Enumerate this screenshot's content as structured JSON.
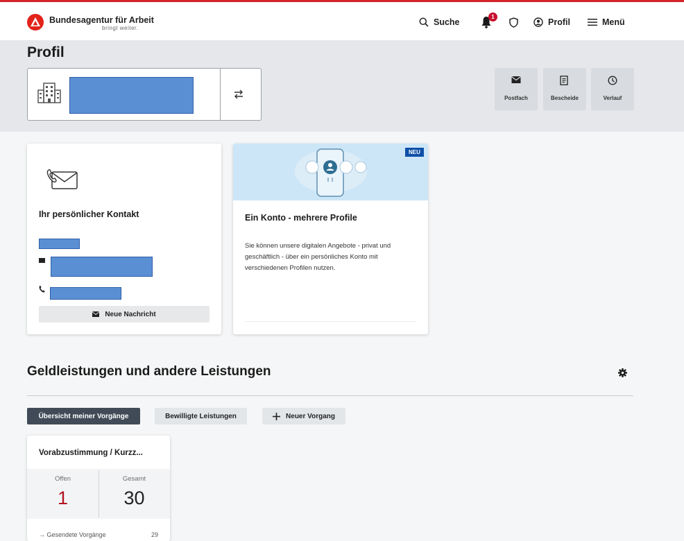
{
  "header": {
    "brand_name": "Bundesagentur für Arbeit",
    "brand_tagline": "bringt weiter.",
    "nav": {
      "search_label": "Suche",
      "notification_count": "1",
      "profile_label": "Profil",
      "menu_label": "Menü"
    }
  },
  "page": {
    "title": "Profil"
  },
  "quick_actions": [
    {
      "label": "Postfach",
      "icon": "envelope-icon"
    },
    {
      "label": "Bescheide",
      "icon": "document-icon"
    },
    {
      "label": "Verlauf",
      "icon": "clock-icon"
    }
  ],
  "contact_card": {
    "heading": "Ihr persönlicher Kontakt",
    "new_message_label": "Neue Nachricht"
  },
  "konto_card": {
    "badge": "NEU",
    "heading": "Ein Konto - mehrere Profile",
    "text": "Sie können unsere digitalen Angebote - privat und geschäftlich - über ein persönliches Konto mit verschiedenen Profilen nutzen."
  },
  "section": {
    "title": "Geldleistungen und andere Leistungen",
    "tabs": [
      {
        "label": "Übersicht meiner Vorgänge",
        "active": true
      },
      {
        "label": "Bewilligte Leistungen",
        "active": false
      },
      {
        "label": "Neuer Vorgang",
        "active": false
      }
    ]
  },
  "vorgang_card": {
    "title": "Vorabzustimmung / Kurzz...",
    "open_label": "Offen",
    "open_value": "1",
    "total_label": "Gesamt",
    "total_value": "30",
    "sent_label": "→ Gesendete Vorgänge",
    "sent_value": "29"
  },
  "colors": {
    "brand_red": "#e2231a",
    "active_tab": "#404b57",
    "open_value": "#b3121f",
    "neu_badge": "#0f4fa8"
  }
}
